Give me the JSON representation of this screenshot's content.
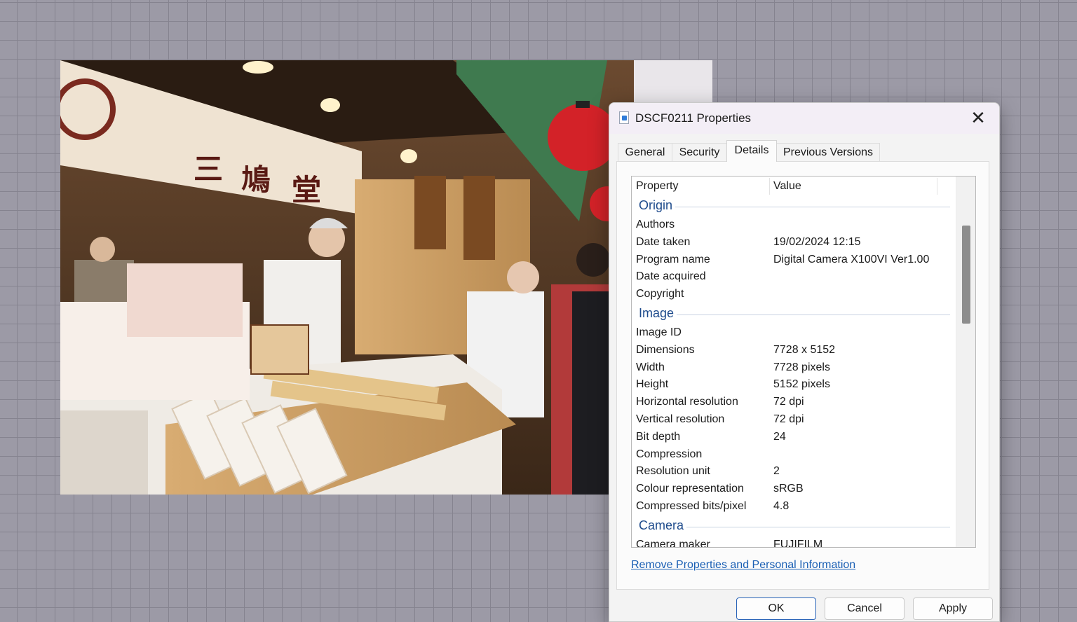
{
  "photo": {
    "alt": "Shop"
  },
  "dialog": {
    "title": "DSCF0211 Properties",
    "close_glyph": "✕",
    "tabs": [
      "General",
      "Security",
      "Details",
      "Previous Versions"
    ],
    "active_tab": "Details",
    "columns": {
      "property": "Property",
      "value": "Value"
    },
    "groups": {
      "origin": {
        "label": "Origin",
        "rows": [
          {
            "k": "Authors",
            "v": ""
          },
          {
            "k": "Date taken",
            "v": "19/02/2024 12:15"
          },
          {
            "k": "Program name",
            "v": "Digital Camera X100VI Ver1.00"
          },
          {
            "k": "Date acquired",
            "v": ""
          },
          {
            "k": "Copyright",
            "v": ""
          }
        ]
      },
      "image": {
        "label": "Image",
        "rows": [
          {
            "k": "Image ID",
            "v": ""
          },
          {
            "k": "Dimensions",
            "v": "7728 x 5152"
          },
          {
            "k": "Width",
            "v": "7728 pixels"
          },
          {
            "k": "Height",
            "v": "5152 pixels"
          },
          {
            "k": "Horizontal resolution",
            "v": "72 dpi"
          },
          {
            "k": "Vertical resolution",
            "v": "72 dpi"
          },
          {
            "k": "Bit depth",
            "v": "24"
          },
          {
            "k": "Compression",
            "v": ""
          },
          {
            "k": "Resolution unit",
            "v": "2"
          },
          {
            "k": "Colour representation",
            "v": "sRGB"
          },
          {
            "k": "Compressed bits/pixel",
            "v": "4.8"
          }
        ]
      },
      "camera": {
        "label": "Camera",
        "rows": [
          {
            "k": "Camera maker",
            "v": "FUJIFILM"
          }
        ]
      }
    },
    "remove_link": "Remove Properties and Personal Information",
    "buttons": {
      "ok": "OK",
      "cancel": "Cancel",
      "apply": "Apply"
    }
  },
  "colors": {
    "accent": "#1a5fb4",
    "group_heading": "#1e4b8c",
    "background": "#9c9aa6"
  },
  "icons": {
    "file": "image-file-icon",
    "close": "close-icon"
  }
}
